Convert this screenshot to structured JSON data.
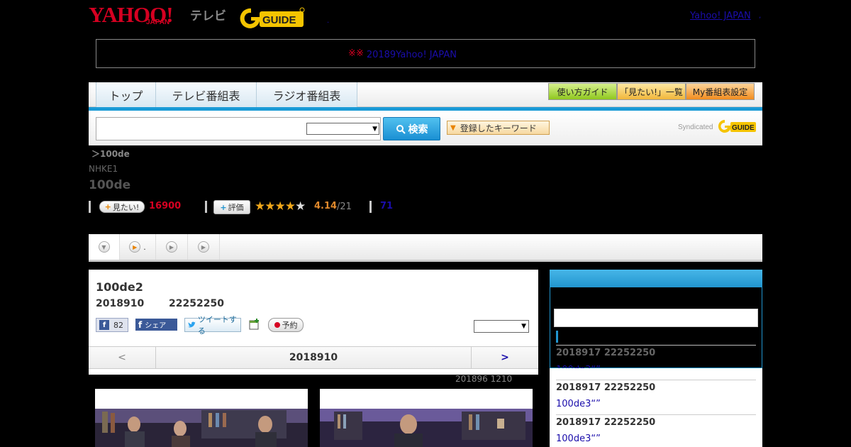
{
  "header": {
    "logo_yahoo": "YAHOO!",
    "logo_japan": "JAPAN",
    "logo_tv": "テレビ",
    "gguide_alt": "G-GUIDE",
    "tiny_dot": ".",
    "yj_link": "Yahoo! JAPAN",
    "yj_dot": ","
  },
  "notice": {
    "mark": "※※",
    "link": "20189Yahoo! JAPAN　　　　　"
  },
  "nav": {
    "tabs": [
      "トップ",
      "テレビ番組表",
      "ラジオ番組表"
    ],
    "guide_buttons": [
      "使い方ガイド",
      "「見たい!」一覧",
      "My番組表設定"
    ]
  },
  "search": {
    "button": "検索",
    "keyword_button": "登録したキーワード",
    "syndicated": "Syndicated"
  },
  "program": {
    "breadcrumb": "＞100de",
    "channel": "NHKE1",
    "title": "100de",
    "mitai_label": "見たい!",
    "mitai_count": "16900",
    "hyouka_label": "評価",
    "rating": "4.14",
    "rating_of": "/21",
    "review_count": "71",
    "stars_full": 4,
    "stars_total": 5
  },
  "actions": {
    "item2_label": "."
  },
  "episode": {
    "title": "100de2",
    "date": "2018910",
    "time": "22252250",
    "fb_like_count": "82",
    "fb_share": "シェア",
    "tweet": "ツイートする",
    "yoyaku": "予約",
    "pager_prev": "<",
    "pager_current": "2018910",
    "pager_next": ">",
    "stamp": "201896  1210"
  },
  "sidebar": {
    "items": [
      {
        "date": "2018917  22252250",
        "link": "100de3“”　　　　　"
      },
      {
        "date": "2018917  22252250",
        "link": "100de3“”　　　　　"
      },
      {
        "date": "2018917  22252250",
        "link": "100de3“”　　　　　"
      }
    ]
  },
  "colors": {
    "yahoo_red": "#d60021",
    "accent_blue": "#1a9ad6",
    "link": "#1a0dab"
  }
}
